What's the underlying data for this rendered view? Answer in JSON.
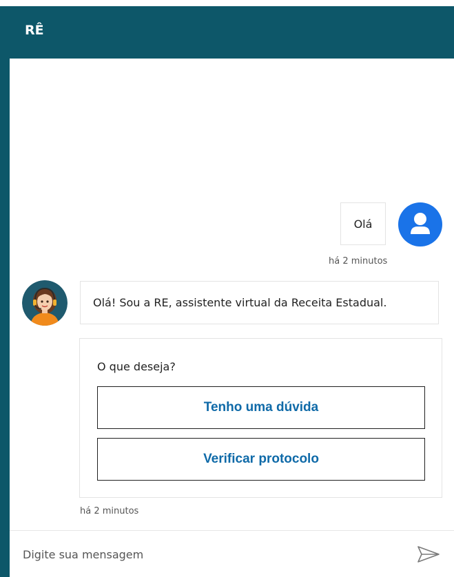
{
  "header": {
    "title": "RÊ"
  },
  "conversation": {
    "user_message": {
      "text": "Olá",
      "time": "há 2 minutos",
      "avatar_icon": "user-icon"
    },
    "bot_message": {
      "text": "Olá! Sou a RE, assistente virtual da Receita Estadual.",
      "avatar_icon": "assistant-avatar"
    },
    "options": {
      "prompt": "O que deseja?",
      "buttons": [
        "Tenho uma dúvida",
        "Verificar protocolo"
      ],
      "time": "há 2 minutos"
    }
  },
  "composer": {
    "placeholder": "Digite sua mensagem",
    "send_icon": "send-icon"
  },
  "colors": {
    "header_bg": "#0d5769",
    "user_avatar": "#1a73e8",
    "button_text": "#0f6aa8"
  }
}
